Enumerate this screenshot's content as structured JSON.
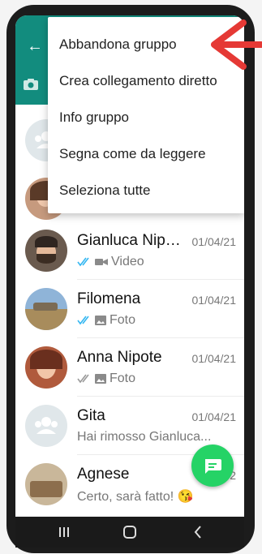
{
  "menu": {
    "items": [
      "Abbandona gruppo",
      "Crea collegamento diretto",
      "Info gruppo",
      "Segna come da leggere",
      "Seleziona tutte"
    ]
  },
  "chats": [
    {
      "name": "Gianluca Nip…",
      "date": "01/04/21",
      "preview": "Video",
      "status": "read",
      "media": "video-icon"
    },
    {
      "name": "Filomena",
      "date": "01/04/21",
      "preview": "Foto",
      "status": "read",
      "media": "photo-icon"
    },
    {
      "name": "Anna Nipote",
      "date": "01/04/21",
      "preview": "Foto",
      "status": "delivered",
      "media": "photo-icon"
    },
    {
      "name": "Gita",
      "date": "01/04/21",
      "preview": "Hai rimosso Gianluca..."
    },
    {
      "name": "Agnese",
      "date": "2",
      "preview": "Certo, sarà fatto! 😘"
    }
  ],
  "colors": {
    "teal": "#128c7e",
    "green": "#25d366",
    "check_blue": "#34b7f1",
    "arrow_red": "#e53935"
  }
}
